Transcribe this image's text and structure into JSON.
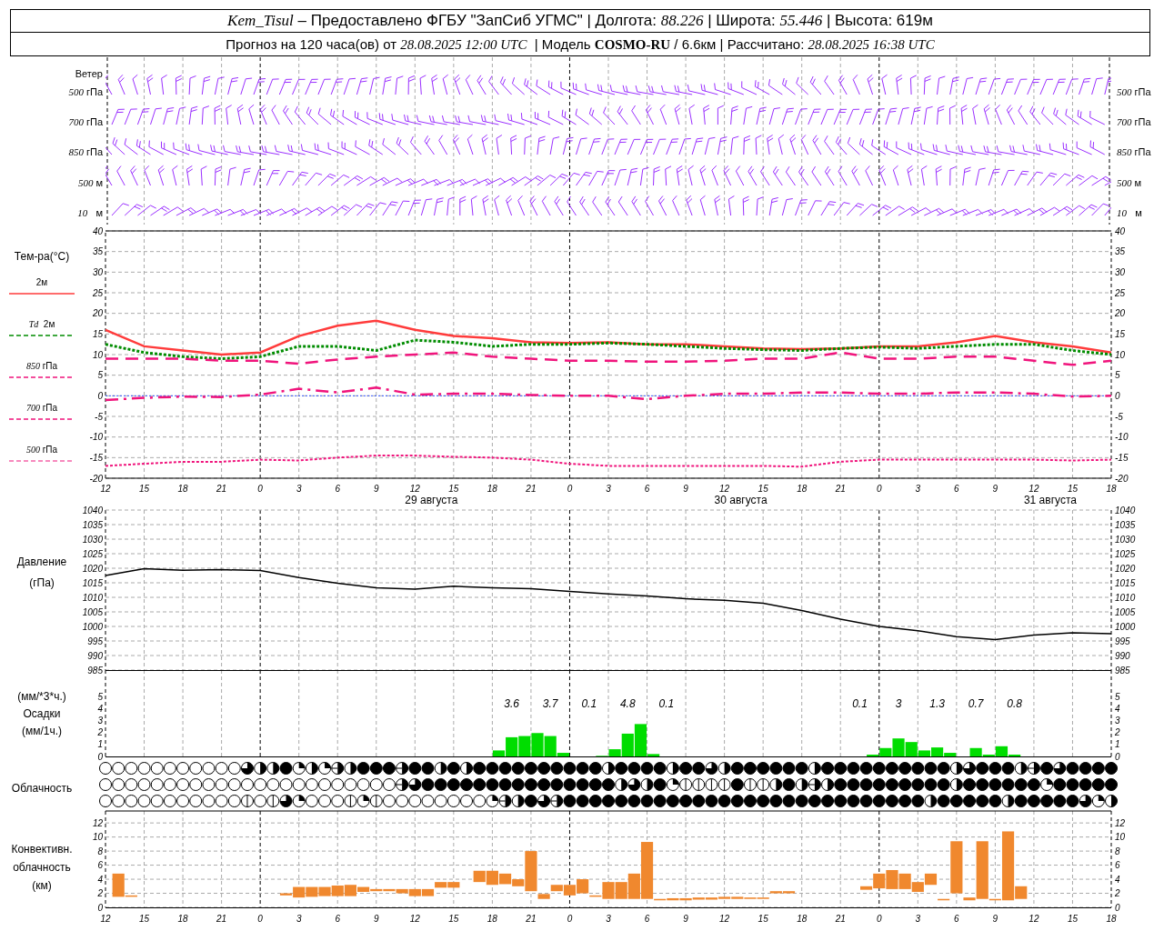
{
  "header": {
    "line_1": "*Kem_Tisul* – Предоставлено ФГБУ \"ЗапСиб УГМС\" | Долгота: *88.226* | Широта: *55.446* | Высота: 619м",
    "line_2": "Прогноз на 120 часа(ов) от *28.08.2025 12:00 UTC*  | Модель **COSMO-RU** / 6.6км | Рассчитано: *28.08.2025 16:38 UTC*"
  },
  "wind": {
    "labels_left": [
      "Ветер",
      "*500* гПа",
      "*700* гПа",
      "*850* гПа",
      "*500* м",
      "*10*   м"
    ],
    "labels_right": [
      "*500* гПа",
      "*700* гПа",
      "*850* гПа",
      "*500* м",
      "*10*   м"
    ]
  },
  "temperature": {
    "title": "Тем-ра(°C)",
    "legend": [
      "2м",
      "*Td*  2м",
      "*850* гПа",
      "*700* гПа",
      "*500* гПа"
    ],
    "date_labels": [
      "29 августа",
      "30 августа",
      "31 августа"
    ],
    "right_ticks": [
      "40",
      "35",
      "30",
      "25",
      "20",
      "15",
      "10",
      "5",
      "0",
      "-5",
      "-10",
      "-15",
      "-20"
    ],
    "chart_data": {
      "type": "line",
      "categories": [
        "12",
        "15",
        "18",
        "21",
        "0",
        "3",
        "6",
        "9",
        "12",
        "15",
        "18",
        "21",
        "0",
        "3",
        "6",
        "9",
        "12",
        "15",
        "18",
        "21",
        "0",
        "3",
        "6",
        "9",
        "12",
        "15",
        "18"
      ],
      "ylim": [
        -20,
        40
      ],
      "yticks": [
        -20,
        -15,
        -10,
        -5,
        0,
        5,
        10,
        15,
        20,
        25,
        30,
        35,
        40
      ],
      "grid": true,
      "ref_lines": [
        {
          "axis": "y",
          "value": 0,
          "color": "#3355ff"
        }
      ],
      "series": [
        {
          "color": "#ff3b3b",
          "line_style": "solid",
          "values": [
            16,
            12,
            11,
            10,
            10.5,
            14.5,
            17,
            18.2,
            16,
            14.5,
            14,
            13,
            12.8,
            13,
            12.5,
            12.5,
            12,
            11.5,
            11.3,
            11.5,
            12,
            12,
            13,
            14.5,
            13,
            12,
            10.5
          ]
        },
        {
          "color": "#008c00",
          "line_style": "dotted",
          "values": [
            12.5,
            10.5,
            9.5,
            9,
            9.5,
            12,
            12,
            11,
            13.5,
            13,
            12,
            12.5,
            12.5,
            12.8,
            12.5,
            12,
            11.5,
            11.2,
            11,
            11.5,
            11.8,
            11.5,
            12,
            12.5,
            12.5,
            11,
            10
          ]
        },
        {
          "color": "#f0147c",
          "line_style": "dashed",
          "values": [
            9,
            9,
            9,
            8.5,
            8.5,
            7.8,
            8.8,
            9.5,
            10,
            10.5,
            9.5,
            9,
            8.5,
            8.5,
            8.3,
            8.3,
            8.5,
            9,
            9,
            10.5,
            9,
            9,
            9.5,
            9.5,
            8.5,
            7.5,
            8.5
          ]
        },
        {
          "color": "#f0147c",
          "line_style": "dashdot",
          "values": [
            -1,
            -0.5,
            -0.2,
            -0.3,
            0.3,
            1.7,
            0.8,
            2,
            0.3,
            0.5,
            0.5,
            0.2,
            0,
            0,
            -0.8,
            0,
            0.5,
            0.5,
            0.8,
            0.8,
            0.5,
            0.5,
            0.8,
            0.8,
            0.5,
            -0.2,
            0
          ]
        },
        {
          "color": "#f0147c",
          "line_style": "dotted",
          "values": [
            -17,
            -16.5,
            -16,
            -16,
            -15.5,
            -15.7,
            -15,
            -14.5,
            -14.5,
            -14.8,
            -15,
            -15.5,
            -16.5,
            -17,
            -17,
            -17,
            -17,
            -17,
            -17.2,
            -16,
            -15.5,
            -15.5,
            -15.5,
            -15.5,
            -15.5,
            -15.7,
            -15.5
          ]
        }
      ]
    }
  },
  "pressure": {
    "labels": [
      "Давление",
      "(гПа)"
    ],
    "right_ticks": [
      "1040",
      "1035",
      "1030",
      "1025",
      "1020",
      "1015",
      "1010",
      "1005",
      "1000",
      "995",
      "990",
      "985"
    ],
    "chart_data": {
      "type": "line",
      "categories": [
        null,
        null,
        null,
        null,
        null,
        null,
        null,
        null,
        null,
        null,
        null,
        null,
        null,
        null,
        null,
        null,
        null,
        null,
        null,
        null,
        null,
        null,
        null,
        null,
        null,
        null,
        null
      ],
      "ylim": [
        985,
        1040
      ],
      "yticks": [
        985,
        990,
        995,
        1000,
        1005,
        1010,
        1015,
        1020,
        1025,
        1030,
        1035,
        1040
      ],
      "grid": true,
      "series": [
        {
          "color": "#000000",
          "line_style": "solid",
          "values": [
            1017.5,
            1019.8,
            1019.3,
            1019.5,
            1019.2,
            1016.8,
            1014.8,
            1013.3,
            1012.8,
            1013.8,
            1013.3,
            1013,
            1012,
            1011.2,
            1010.5,
            1009.5,
            1009,
            1008,
            1005.5,
            1002.5,
            1000,
            998.5,
            996.5,
            995.5,
            997,
            997.8,
            997.5
          ]
        }
      ]
    }
  },
  "precipitation": {
    "labels": [
      "(мм/*3*ч.)",
      "Осадки",
      "(мм/1ч.)"
    ],
    "right_ticks": [
      "5",
      "4",
      "3",
      "2",
      "1",
      "0"
    ],
    "chart_data": {
      "type": "bar",
      "categories": [
        null,
        null,
        null,
        null,
        null,
        null,
        null,
        null,
        null,
        null,
        null,
        null,
        null,
        null,
        null,
        null,
        null,
        null,
        null,
        null,
        null,
        null,
        null,
        null,
        null,
        null,
        null,
        null,
        null,
        null,
        null,
        null,
        null,
        null,
        null,
        null,
        null,
        null,
        null,
        null,
        null,
        null,
        null,
        null,
        null,
        null,
        null,
        null,
        null,
        null,
        null,
        null,
        null,
        null,
        null,
        null,
        null,
        null,
        null,
        null,
        null,
        null,
        null,
        null,
        null,
        null,
        null,
        null,
        null,
        null,
        null,
        null,
        null,
        null,
        null,
        null,
        null,
        null
      ],
      "ylim": [
        0,
        7.2
      ],
      "yticks": [
        0,
        1,
        2,
        3,
        4,
        5
      ],
      "series": [
        {
          "color": "#00dd00",
          "values": [
            0,
            0,
            0,
            0,
            0,
            0,
            0,
            0,
            0,
            0,
            0,
            0,
            0,
            0,
            0,
            0,
            0,
            0,
            0,
            0,
            0,
            0,
            0,
            0,
            0,
            0,
            0,
            0,
            0,
            0,
            0.5,
            1.6,
            1.7,
            1.95,
            1.7,
            0.3,
            0,
            0,
            0.05,
            0.6,
            1.9,
            2.7,
            0.2,
            0,
            0,
            0,
            0,
            0,
            0,
            0,
            0,
            0,
            0,
            0,
            0,
            0,
            0,
            0,
            0,
            0.15,
            0.7,
            1.5,
            1.2,
            0.5,
            0.75,
            0.3,
            0,
            0.7,
            0.15,
            0.85,
            0.15,
            0,
            0,
            0,
            0,
            0,
            0,
            0
          ]
        }
      ],
      "annotations": [
        "3.6",
        "3.7",
        "0.1",
        "4.8",
        "0.1",
        "0.1",
        "3",
        "1.3",
        "0.7",
        "0.8"
      ]
    }
  },
  "cloudiness": {
    "label": "Облачность",
    "rows": [
      {
        "cover": [
          {
            "kind": "clear"
          },
          {
            "kind": "clear"
          },
          {
            "kind": "clear"
          },
          {
            "kind": "clear"
          },
          {
            "kind": "clear"
          },
          {
            "kind": "clear"
          },
          {
            "kind": "clear"
          },
          {
            "kind": "clear"
          },
          {
            "kind": "clear"
          },
          {
            "kind": "clear"
          },
          {
            "kind": "clear"
          },
          {
            "kind": "threequarter"
          },
          {
            "kind": "half"
          },
          {
            "kind": "half"
          },
          {
            "kind": "full"
          },
          {
            "kind": "quarter"
          },
          {
            "kind": "half"
          },
          {
            "kind": "quarter"
          },
          {
            "kind": "halfbar"
          },
          {
            "kind": "half"
          },
          {
            "kind": "full"
          },
          {
            "kind": "full"
          },
          {
            "kind": "full"
          },
          {
            "kind": "halfbar"
          },
          {
            "kind": "full"
          },
          {
            "kind": "full"
          },
          {
            "kind": "half"
          },
          {
            "kind": "full"
          },
          {
            "kind": "half"
          },
          {
            "kind": "full"
          },
          {
            "kind": "full"
          },
          {
            "kind": "full"
          },
          {
            "kind": "full"
          },
          {
            "kind": "full"
          },
          {
            "kind": "full"
          },
          {
            "kind": "full"
          },
          {
            "kind": "full"
          },
          {
            "kind": "full"
          },
          {
            "kind": "full"
          },
          {
            "kind": "half"
          },
          {
            "kind": "full"
          },
          {
            "kind": "full"
          },
          {
            "kind": "full"
          },
          {
            "kind": "full"
          },
          {
            "kind": "half"
          },
          {
            "kind": "full"
          },
          {
            "kind": "full"
          },
          {
            "kind": "threequarter"
          },
          {
            "kind": "half"
          },
          {
            "kind": "full"
          },
          {
            "kind": "full"
          },
          {
            "kind": "full"
          },
          {
            "kind": "full"
          },
          {
            "kind": "full"
          },
          {
            "kind": "full"
          },
          {
            "kind": "half"
          },
          {
            "kind": "full"
          },
          {
            "kind": "full"
          },
          {
            "kind": "full"
          },
          {
            "kind": "full"
          },
          {
            "kind": "full"
          },
          {
            "kind": "full"
          },
          {
            "kind": "full"
          },
          {
            "kind": "full"
          },
          {
            "kind": "full"
          },
          {
            "kind": "full"
          },
          {
            "kind": "half"
          },
          {
            "kind": "threequarter"
          },
          {
            "kind": "full"
          },
          {
            "kind": "full"
          },
          {
            "kind": "full"
          },
          {
            "kind": "half"
          },
          {
            "kind": "halfbar"
          },
          {
            "kind": "full"
          },
          {
            "kind": "threequarter"
          },
          {
            "kind": "full"
          },
          {
            "kind": "full"
          },
          {
            "kind": "full"
          },
          {
            "kind": "full"
          }
        ]
      },
      {
        "cover": [
          {
            "kind": "clear"
          },
          {
            "kind": "clear"
          },
          {
            "kind": "clear"
          },
          {
            "kind": "clear"
          },
          {
            "kind": "clear"
          },
          {
            "kind": "clear"
          },
          {
            "kind": "clear"
          },
          {
            "kind": "clear"
          },
          {
            "kind": "clear"
          },
          {
            "kind": "clear"
          },
          {
            "kind": "clear"
          },
          {
            "kind": "clear"
          },
          {
            "kind": "clear"
          },
          {
            "kind": "clear"
          },
          {
            "kind": "clear"
          },
          {
            "kind": "clear"
          },
          {
            "kind": "clear"
          },
          {
            "kind": "clear"
          },
          {
            "kind": "clear"
          },
          {
            "kind": "clear"
          },
          {
            "kind": "clear"
          },
          {
            "kind": "clear"
          },
          {
            "kind": "clear"
          },
          {
            "kind": "halfbar"
          },
          {
            "kind": "threequarter"
          },
          {
            "kind": "full"
          },
          {
            "kind": "full"
          },
          {
            "kind": "full"
          },
          {
            "kind": "full"
          },
          {
            "kind": "full"
          },
          {
            "kind": "full"
          },
          {
            "kind": "full"
          },
          {
            "kind": "full"
          },
          {
            "kind": "full"
          },
          {
            "kind": "full"
          },
          {
            "kind": "full"
          },
          {
            "kind": "full"
          },
          {
            "kind": "full"
          },
          {
            "kind": "full"
          },
          {
            "kind": "full"
          },
          {
            "kind": "half"
          },
          {
            "kind": "threequarter"
          },
          {
            "kind": "half"
          },
          {
            "kind": "full"
          },
          {
            "kind": "quarter"
          },
          {
            "kind": "line"
          },
          {
            "kind": "line"
          },
          {
            "kind": "line"
          },
          {
            "kind": "line"
          },
          {
            "kind": "full"
          },
          {
            "kind": "line"
          },
          {
            "kind": "line"
          },
          {
            "kind": "half"
          },
          {
            "kind": "full"
          },
          {
            "kind": "half"
          },
          {
            "kind": "halfbar"
          },
          {
            "kind": "half"
          },
          {
            "kind": "full"
          },
          {
            "kind": "full"
          },
          {
            "kind": "full"
          },
          {
            "kind": "full"
          },
          {
            "kind": "full"
          },
          {
            "kind": "full"
          },
          {
            "kind": "full"
          },
          {
            "kind": "full"
          },
          {
            "kind": "full"
          },
          {
            "kind": "half"
          },
          {
            "kind": "full"
          },
          {
            "kind": "full"
          },
          {
            "kind": "full"
          },
          {
            "kind": "full"
          },
          {
            "kind": "full"
          },
          {
            "kind": "full"
          },
          {
            "kind": "quarter"
          },
          {
            "kind": "full"
          },
          {
            "kind": "full"
          },
          {
            "kind": "full"
          },
          {
            "kind": "full"
          },
          {
            "kind": "full"
          }
        ]
      },
      {
        "cover": [
          {
            "kind": "clear"
          },
          {
            "kind": "clear"
          },
          {
            "kind": "clear"
          },
          {
            "kind": "clear"
          },
          {
            "kind": "clear"
          },
          {
            "kind": "clear"
          },
          {
            "kind": "clear"
          },
          {
            "kind": "clear"
          },
          {
            "kind": "clear"
          },
          {
            "kind": "clear"
          },
          {
            "kind": "clear"
          },
          {
            "kind": "line"
          },
          {
            "kind": "clear"
          },
          {
            "kind": "line"
          },
          {
            "kind": "threequarter"
          },
          {
            "kind": "quarter"
          },
          {
            "kind": "clear"
          },
          {
            "kind": "clear"
          },
          {
            "kind": "clear"
          },
          {
            "kind": "line"
          },
          {
            "kind": "quarter"
          },
          {
            "kind": "line"
          },
          {
            "kind": "clear"
          },
          {
            "kind": "clear"
          },
          {
            "kind": "clear"
          },
          {
            "kind": "clear"
          },
          {
            "kind": "clear"
          },
          {
            "kind": "clear"
          },
          {
            "kind": "clear"
          },
          {
            "kind": "clear"
          },
          {
            "kind": "quarter"
          },
          {
            "kind": "halfbar"
          },
          {
            "kind": "half"
          },
          {
            "kind": "full"
          },
          {
            "kind": "threequarter"
          },
          {
            "kind": "halfbar"
          },
          {
            "kind": "full"
          },
          {
            "kind": "full"
          },
          {
            "kind": "full"
          },
          {
            "kind": "full"
          },
          {
            "kind": "full"
          },
          {
            "kind": "full"
          },
          {
            "kind": "full"
          },
          {
            "kind": "full"
          },
          {
            "kind": "full"
          },
          {
            "kind": "full"
          },
          {
            "kind": "full"
          },
          {
            "kind": "full"
          },
          {
            "kind": "full"
          },
          {
            "kind": "full"
          },
          {
            "kind": "full"
          },
          {
            "kind": "full"
          },
          {
            "kind": "full"
          },
          {
            "kind": "full"
          },
          {
            "kind": "full"
          },
          {
            "kind": "full"
          },
          {
            "kind": "full"
          },
          {
            "kind": "full"
          },
          {
            "kind": "full"
          },
          {
            "kind": "full"
          },
          {
            "kind": "full"
          },
          {
            "kind": "full"
          },
          {
            "kind": "full"
          },
          {
            "kind": "full"
          },
          {
            "kind": "half"
          },
          {
            "kind": "full"
          },
          {
            "kind": "full"
          },
          {
            "kind": "full"
          },
          {
            "kind": "full"
          },
          {
            "kind": "full"
          },
          {
            "kind": "half"
          },
          {
            "kind": "full"
          },
          {
            "kind": "full"
          },
          {
            "kind": "full"
          },
          {
            "kind": "full"
          },
          {
            "kind": "full"
          },
          {
            "kind": "threequarter"
          },
          {
            "kind": "quarter"
          },
          {
            "kind": "half"
          }
        ]
      }
    ]
  },
  "convective": {
    "labels": [
      "Конвективн.",
      "облачность",
      "(км)"
    ],
    "right_ticks": [
      "12",
      "10",
      "8",
      "6",
      "4",
      "2",
      "0"
    ],
    "chart_data": {
      "type": "candlestick",
      "grid": true,
      "color": "#f0882e",
      "categories": [
        "12",
        null,
        null,
        "15",
        null,
        null,
        "18",
        null,
        null,
        "21",
        null,
        null,
        "0",
        null,
        null,
        "3",
        null,
        null,
        "6",
        null,
        null,
        "9",
        null,
        null,
        "12",
        null,
        null,
        "15",
        null,
        null,
        "18",
        null,
        null,
        "21",
        null,
        null,
        "0",
        null,
        null,
        "3",
        null,
        null,
        "6",
        null,
        null,
        "9",
        null,
        null,
        "12",
        null,
        null,
        "15",
        null,
        null,
        "18",
        null,
        null,
        "21",
        null,
        null,
        "0",
        null,
        null,
        "3",
        null,
        null,
        "6",
        null,
        null,
        "9",
        null,
        null,
        "12",
        null,
        null,
        "15",
        null,
        null,
        "18"
      ],
      "ylim": [
        0,
        13.7
      ],
      "yticks": [
        0,
        2,
        4,
        6,
        8,
        10,
        12
      ],
      "ohlc": [
        null,
        [
          1.5,
          4.8,
          1.5,
          4.8
        ],
        [
          1.5,
          1.7,
          1.5,
          1.7
        ],
        null,
        null,
        null,
        null,
        null,
        null,
        null,
        null,
        null,
        null,
        null,
        [
          1.7,
          2.0,
          1.7,
          2.0
        ],
        [
          1.4,
          2.9,
          1.4,
          2.9
        ],
        [
          1.5,
          2.9,
          1.5,
          2.9
        ],
        [
          1.6,
          2.9,
          1.6,
          2.9
        ],
        [
          1.6,
          3.1,
          1.6,
          3.1
        ],
        [
          1.6,
          3.2,
          1.6,
          3.2
        ],
        [
          2.2,
          2.9,
          2.2,
          2.9
        ],
        [
          2.3,
          2.6,
          2.3,
          2.6
        ],
        [
          2.3,
          2.6,
          2.3,
          2.6
        ],
        [
          2.0,
          2.6,
          2.0,
          2.6
        ],
        [
          1.6,
          2.6,
          1.6,
          2.6
        ],
        [
          1.6,
          2.6,
          1.6,
          2.6
        ],
        [
          2.8,
          3.6,
          2.8,
          3.6
        ],
        [
          2.8,
          3.6,
          2.8,
          3.6
        ],
        null,
        [
          3.6,
          5.2,
          3.6,
          5.2
        ],
        [
          3.2,
          5.2,
          3.2,
          5.2
        ],
        [
          3.3,
          4.8,
          3.3,
          4.8
        ],
        [
          3.0,
          4.0,
          3.0,
          4.0
        ],
        [
          2.3,
          8.0,
          2.3,
          8.0
        ],
        [
          1.2,
          1.9,
          1.2,
          1.9
        ],
        [
          2.3,
          3.2,
          2.3,
          3.2
        ],
        [
          1.7,
          3.2,
          1.7,
          3.2
        ],
        [
          2.0,
          4.0,
          2.0,
          4.0
        ],
        [
          1.5,
          1.7,
          1.5,
          1.7
        ],
        [
          1.2,
          3.6,
          1.2,
          3.6
        ],
        [
          1.2,
          3.6,
          1.2,
          3.6
        ],
        [
          1.2,
          4.8,
          1.2,
          4.8
        ],
        [
          1.2,
          9.3,
          1.2,
          9.3
        ],
        [
          1.0,
          1.2,
          1.0,
          1.2
        ],
        [
          1.0,
          1.3,
          1.0,
          1.3
        ],
        [
          1.0,
          1.3,
          1.0,
          1.3
        ],
        [
          1.1,
          1.4,
          1.1,
          1.4
        ],
        [
          1.1,
          1.4,
          1.1,
          1.4
        ],
        [
          1.2,
          1.5,
          1.2,
          1.5
        ],
        [
          1.2,
          1.5,
          1.2,
          1.5
        ],
        [
          1.2,
          1.4,
          1.2,
          1.4
        ],
        [
          1.2,
          1.4,
          1.2,
          1.4
        ],
        [
          2.0,
          2.3,
          2.0,
          2.3
        ],
        [
          2.0,
          2.3,
          2.0,
          2.3
        ],
        null,
        null,
        null,
        null,
        null,
        [
          2.5,
          3.0,
          2.5,
          3.0
        ],
        [
          2.7,
          4.8,
          2.7,
          4.8
        ],
        [
          2.6,
          5.3,
          2.6,
          5.3
        ],
        [
          2.6,
          4.8,
          2.6,
          4.8
        ],
        [
          2.2,
          3.6,
          2.2,
          3.6
        ],
        [
          3.2,
          4.8,
          3.2,
          4.8
        ],
        [
          1.0,
          1.2,
          1.0,
          1.2
        ],
        [
          2.0,
          9.4,
          2.0,
          9.4
        ],
        [
          1.0,
          1.4,
          1.0,
          1.4
        ],
        [
          1.2,
          9.4,
          1.2,
          9.4
        ],
        [
          1.0,
          1.2,
          1.0,
          1.2
        ],
        [
          1.0,
          10.8,
          1.0,
          10.8
        ],
        [
          1.2,
          3.0,
          1.2,
          3.0
        ],
        null,
        null,
        null,
        null,
        null,
        null,
        null
      ]
    }
  }
}
